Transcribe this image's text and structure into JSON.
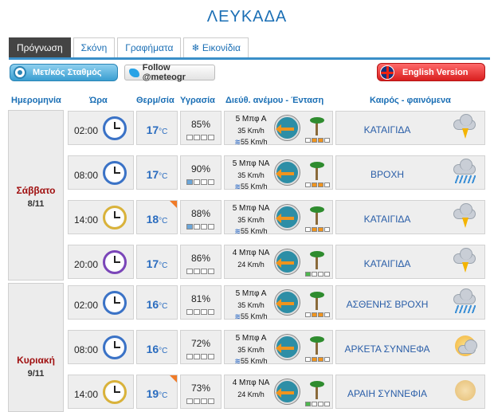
{
  "page_title": "ΛΕΥΚΑΔΑ",
  "tabs": [
    {
      "label": "Πρόγνωση",
      "active": true
    },
    {
      "label": "Σκόνη"
    },
    {
      "label": "Γραφήματα"
    },
    {
      "label": "❄ Εικονίδια"
    }
  ],
  "toolbar": {
    "station_button": "Μετ/κός Σταθμός",
    "follow_button": "Follow @meteogr",
    "english_button": "English Version"
  },
  "headers": {
    "date": "Ημερομηνία",
    "time": "Ώρα",
    "temp": "Θερμ/σία",
    "humidity": "Υγρασία",
    "wind": "Διεύθ. ανέμου - Ένταση",
    "weather": "Καιρός - φαινόμενα"
  },
  "days": [
    {
      "name": "Σάββατο",
      "date": "8/11"
    },
    {
      "name": "Κυριακή",
      "date": "9/11"
    }
  ],
  "rows": [
    {
      "time": "02:00",
      "temp": "17",
      "unit": "°C",
      "humidity": "85%",
      "humidity_level": 0.85,
      "wind_speed": "5 Μπφ Α",
      "wind_kmh": "35 Km/h",
      "gust": "55 Km/h",
      "weather": "ΚΑΤΑΙΓΙΔΑ",
      "weather_icon": "thunderstorm-icon"
    },
    {
      "time": "08:00",
      "temp": "17",
      "unit": "°C",
      "humidity": "90%",
      "humidity_level": 0.9,
      "wind_speed": "5 Μπφ ΝΑ",
      "wind_kmh": "35 Km/h",
      "gust": "55 Km/h",
      "weather": "ΒΡΟΧΗ",
      "weather_icon": "rain-icon"
    },
    {
      "time": "14:00",
      "temp": "18",
      "unit": "°C",
      "humidity": "88%",
      "humidity_level": 0.88,
      "wind_speed": "5 Μπφ ΝΑ",
      "wind_kmh": "35 Km/h",
      "gust": "55 Km/h",
      "weather": "ΚΑΤΑΙΓΙΔΑ",
      "weather_icon": "thunderstorm-icon"
    },
    {
      "time": "20:00",
      "temp": "17",
      "unit": "°C",
      "humidity": "86%",
      "humidity_level": 0.86,
      "wind_speed": "4 Μπφ ΝΑ",
      "wind_kmh": "24 Km/h",
      "gust": "",
      "weather": "ΚΑΤΑΙΓΙΔΑ",
      "weather_icon": "thunderstorm-icon"
    },
    {
      "time": "02:00",
      "temp": "16",
      "unit": "°C",
      "humidity": "81%",
      "humidity_level": 0.81,
      "wind_speed": "5 Μπφ Α",
      "wind_kmh": "35 Km/h",
      "gust": "55 Km/h",
      "weather": "ΑΣΘΕΝΗΣ ΒΡΟΧΗ",
      "weather_icon": "light-rain-icon"
    },
    {
      "time": "08:00",
      "temp": "16",
      "unit": "°C",
      "humidity": "72%",
      "humidity_level": 0.72,
      "wind_speed": "5 Μπφ Α",
      "wind_kmh": "35 Km/h",
      "gust": "55 Km/h",
      "weather": "ΑΡΚΕΤΑ ΣΥΝΝΕΦΑ",
      "weather_icon": "partly-cloudy-icon"
    },
    {
      "time": "14:00",
      "temp": "19",
      "unit": "°C",
      "humidity": "73%",
      "humidity_level": 0.73,
      "wind_speed": "4 Μπφ ΝΑ",
      "wind_kmh": "24 Km/h",
      "gust": "",
      "weather": "ΑΡΑΙΗ ΣΥΝΝΕΦΙΑ",
      "weather_icon": "few-clouds-icon"
    }
  ]
}
